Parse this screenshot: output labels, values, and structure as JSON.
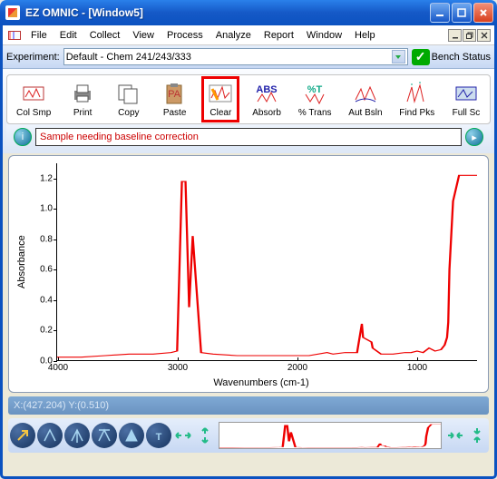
{
  "window": {
    "title": "EZ OMNIC  -  [Window5]"
  },
  "menu": [
    "File",
    "Edit",
    "Collect",
    "View",
    "Process",
    "Analyze",
    "Report",
    "Window",
    "Help"
  ],
  "experiment": {
    "label": "Experiment:",
    "value": "Default - Chem 241/243/333"
  },
  "bench": {
    "label": "Bench Status"
  },
  "toolbar": [
    {
      "name": "col-smp",
      "label": "Col Smp"
    },
    {
      "name": "print",
      "label": "Print"
    },
    {
      "name": "copy",
      "label": "Copy"
    },
    {
      "name": "paste",
      "label": "Paste"
    },
    {
      "name": "clear",
      "label": "Clear",
      "highlight": true
    },
    {
      "name": "absorb",
      "label": "Absorb"
    },
    {
      "name": "pct-trans",
      "label": "% Trans"
    },
    {
      "name": "aut-bsln",
      "label": "Aut Bsln"
    },
    {
      "name": "find-pks",
      "label": "Find Pks"
    },
    {
      "name": "full-sc",
      "label": "Full Sc"
    }
  ],
  "message": "Sample needing baseline correction",
  "status": "X:(427.204) Y:(0.510)",
  "chart_data": {
    "type": "line",
    "title": "",
    "xlabel": "Wavenumbers (cm-1)",
    "ylabel": "Absorbance",
    "xlim": [
      4000,
      500
    ],
    "ylim": [
      0.0,
      1.3
    ],
    "xticks": [
      4000,
      3000,
      2000,
      1000
    ],
    "yticks": [
      0.0,
      0.2,
      0.4,
      0.6,
      0.8,
      1.0,
      1.2
    ],
    "x": [
      4000,
      3800,
      3600,
      3400,
      3200,
      3050,
      3000,
      2960,
      2930,
      2900,
      2870,
      2800,
      2700,
      2500,
      2300,
      2100,
      1900,
      1750,
      1700,
      1600,
      1500,
      1460,
      1450,
      1380,
      1370,
      1300,
      1200,
      1100,
      1050,
      1000,
      950,
      900,
      850,
      800,
      770,
      750,
      740,
      730,
      700,
      650,
      600,
      550,
      530,
      510,
      500
    ],
    "y": [
      0.02,
      0.02,
      0.03,
      0.04,
      0.04,
      0.05,
      0.06,
      1.18,
      1.18,
      0.35,
      0.82,
      0.05,
      0.04,
      0.03,
      0.03,
      0.03,
      0.03,
      0.05,
      0.04,
      0.05,
      0.05,
      0.24,
      0.15,
      0.12,
      0.08,
      0.04,
      0.04,
      0.05,
      0.05,
      0.06,
      0.05,
      0.08,
      0.06,
      0.07,
      0.1,
      0.15,
      0.25,
      0.6,
      1.05,
      1.22,
      1.22,
      1.22,
      1.22,
      1.22,
      1.22
    ]
  }
}
